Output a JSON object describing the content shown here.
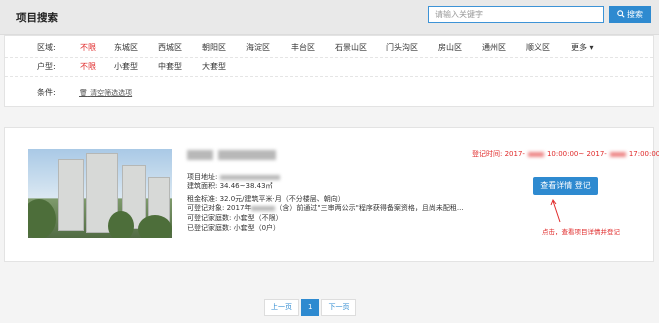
{
  "header": {
    "title": "项目搜索"
  },
  "search": {
    "placeholder": "请输入关键字",
    "button_label": "搜索"
  },
  "filters": {
    "district": {
      "label": "区域:",
      "options": [
        "不限",
        "东城区",
        "西城区",
        "朝阳区",
        "海淀区",
        "丰台区",
        "石景山区",
        "门头沟区",
        "房山区",
        "通州区",
        "顺义区",
        "更多"
      ],
      "selected": "不限"
    },
    "layout": {
      "label": "户型:",
      "options": [
        "不限",
        "小套型",
        "中套型",
        "大套型"
      ],
      "selected": "不限"
    },
    "conditions": {
      "label": "条件:",
      "clear_label": "清空筛选选项"
    }
  },
  "project": {
    "address_label": "项目地址:",
    "area": "建筑面积:  34.46~38.43㎡",
    "rent": "租金标准:  32.0元/建筑平米·月（不分楼层、朝向）",
    "target_prefix": "可登记对象:  2017年",
    "target_suffix": "（含）前通过\"三审两公示\"程序获得备案资格，且尚未配租...",
    "registerable": "可登记家庭数:  小套型（不限）",
    "registered": "已登记家庭数:  小套型（0户）",
    "reg_time_prefix": "登记时间: 2017-",
    "reg_time_mid": "10:00:00~ 2017-",
    "reg_time_suffix": "17:00:00",
    "detail_button": "查看详情 登记",
    "tip": "点击，查看项目详情并登记"
  },
  "pagination": {
    "prev": "上一页",
    "current": "1",
    "next": "下一页"
  },
  "colors": {
    "accent": "#2e8ad0",
    "active": "#e02a2a"
  }
}
